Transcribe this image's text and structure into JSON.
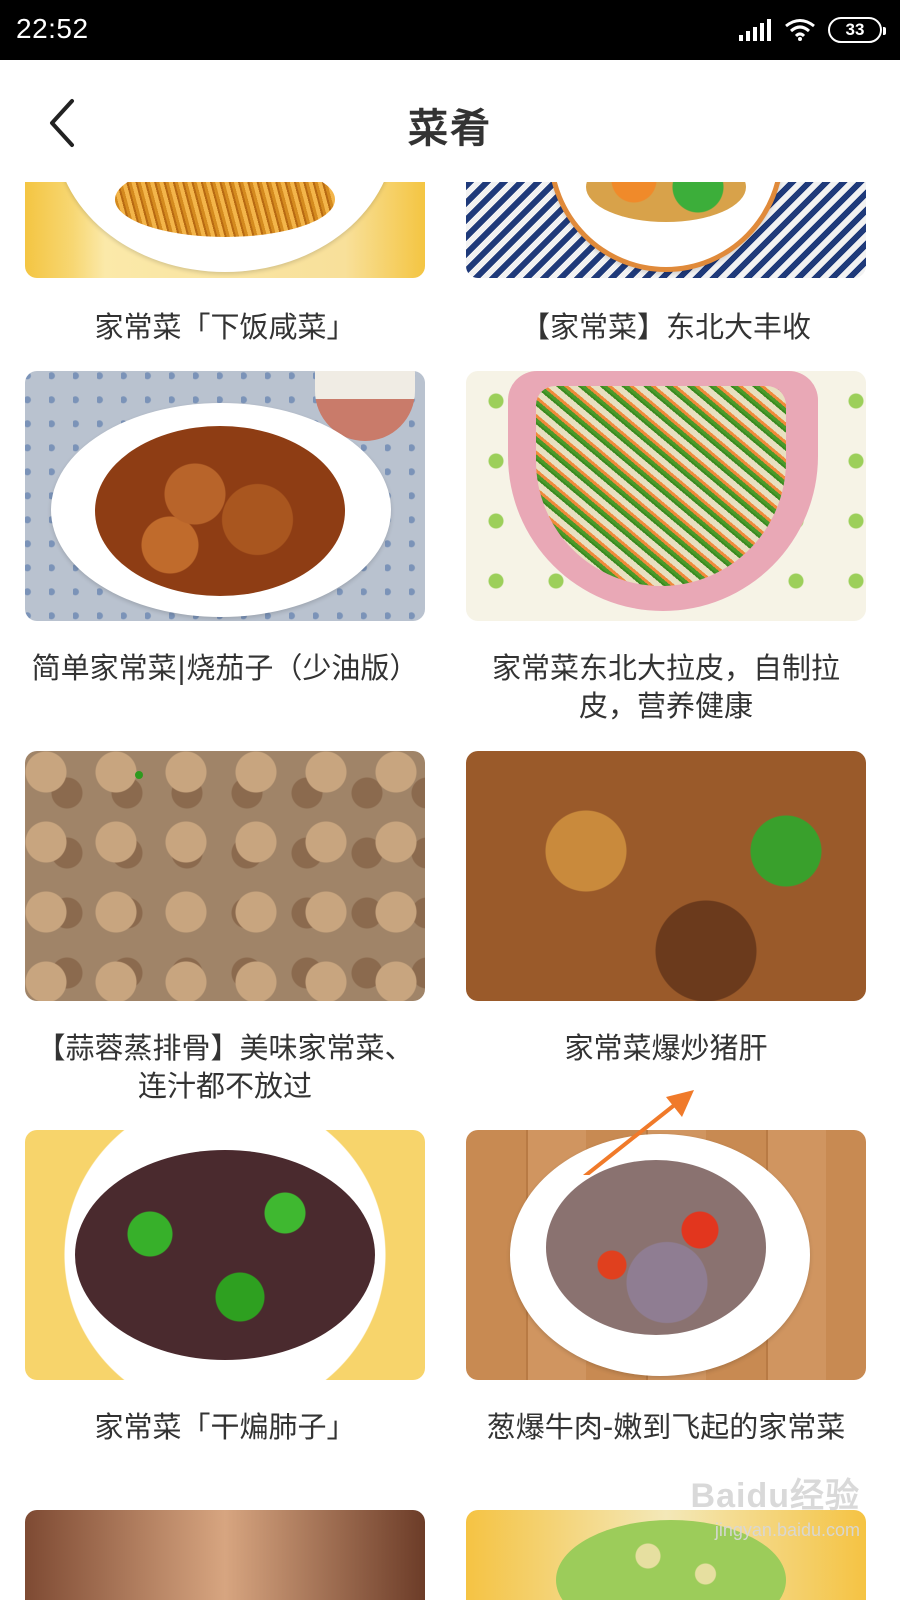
{
  "status_bar": {
    "time": "22:52",
    "battery": "33",
    "icons": [
      "signal-icon",
      "wifi-icon",
      "battery-icon"
    ]
  },
  "header": {
    "title": "菜肴",
    "back_icon": "chevron-left-icon"
  },
  "recipes": [
    {
      "title": "家常菜「下饭咸菜」"
    },
    {
      "title": "【家常菜】东北大丰收"
    },
    {
      "title": "简单家常菜|烧茄子（少油版）"
    },
    {
      "title": "家常菜东北大拉皮，自制拉皮，营养健康"
    },
    {
      "title": "【蒜蓉蒸排骨】美味家常菜、连汁都不放过"
    },
    {
      "title": "家常菜爆炒猪肝"
    },
    {
      "title": "家常菜「干煸肺子」"
    },
    {
      "title": "葱爆牛肉-嫩到飞起的家常菜"
    }
  ],
  "annotation": {
    "color": "#f07a2a"
  },
  "watermark": {
    "logo": "Baidu经验",
    "url": "jingyan.baidu.com"
  }
}
